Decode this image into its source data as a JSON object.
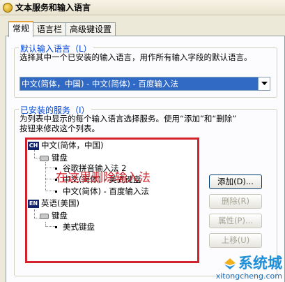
{
  "window": {
    "title": "文本服务和输入语言"
  },
  "tabs": [
    {
      "label": "常规",
      "active": true
    },
    {
      "label": "语言栏",
      "active": false
    },
    {
      "label": "高级键设置",
      "active": false
    }
  ],
  "default_language": {
    "group_title": "默认输入语言（L）",
    "description": "选择其中一个已安装的输入语言，用作所有输入字段的默认语言。",
    "selected": "中文(简体，中国) - 中文(简体) - 百度输入法"
  },
  "installed_services": {
    "group_title": "已安装的服务（I）",
    "description_line1": "为列表中显示的每个输入语言选择服务。使用“添加”和“删除”",
    "description_line2": "按钮来修改这个列表。",
    "tree": {
      "lang1": {
        "badge": "CH",
        "label": "中文(简体，中国)"
      },
      "lang1_group": "键盘",
      "lang1_items": [
        "谷歌拼音输入法 2",
        "中文(简体) - 美式键盘",
        "中文(简体) - 百度输入法"
      ],
      "lang2": {
        "badge": "EN",
        "label": "英语(美国)"
      },
      "lang2_group": "键盘",
      "lang2_items": [
        "美式键盘"
      ]
    },
    "annotation": "在这里删除输入法"
  },
  "buttons": {
    "add": "添加(D)...",
    "remove": "删除(R)",
    "properties": "属性(P)...",
    "move_up": "上移(U)"
  },
  "watermark": {
    "logo": "系统城",
    "url": "xitongcheng.com"
  },
  "colors": {
    "accent": "#316ac5",
    "annotation_red": "#d2222b",
    "watermark_blue": "#1f8fd9"
  }
}
